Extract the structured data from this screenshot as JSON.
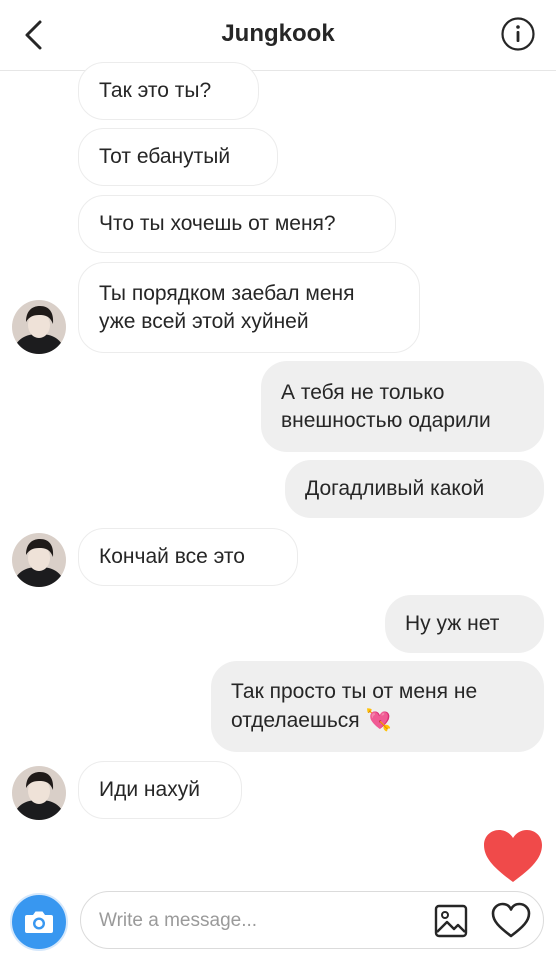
{
  "header": {
    "title": "Jungkook",
    "back_icon": "chevron-left-icon",
    "info_icon": "info-icon"
  },
  "messages": [
    {
      "side": "in",
      "text": "Так это ты?"
    },
    {
      "side": "in",
      "text": "Тот ебанутый"
    },
    {
      "side": "in",
      "text": "Что ты хочешь от меня?"
    },
    {
      "side": "in",
      "text": "Ты порядком заебал меня\nуже всей этой хуйней"
    },
    {
      "side": "out",
      "text": "А тебя не только\nвнешностью одарили"
    },
    {
      "side": "out",
      "text": "Догадливый какой"
    },
    {
      "side": "in",
      "text": "Кончай все это"
    },
    {
      "side": "out",
      "text": "Ну уж нет"
    },
    {
      "side": "out",
      "text": "Так просто ты от меня не\nотделаешься",
      "emoji": "💘"
    },
    {
      "side": "in",
      "text": "Иди нахуй"
    }
  ],
  "composer": {
    "placeholder": "Write a message...",
    "camera_icon": "camera-icon",
    "gallery_icon": "gallery-icon",
    "like_icon": "heart-outline-icon"
  },
  "reaction": {
    "icon": "heart-icon",
    "color": "#f04a4a"
  },
  "colors": {
    "accent": "#3897f0",
    "outgoing_bubble": "#efefef",
    "incoming_border": "#ececec"
  }
}
